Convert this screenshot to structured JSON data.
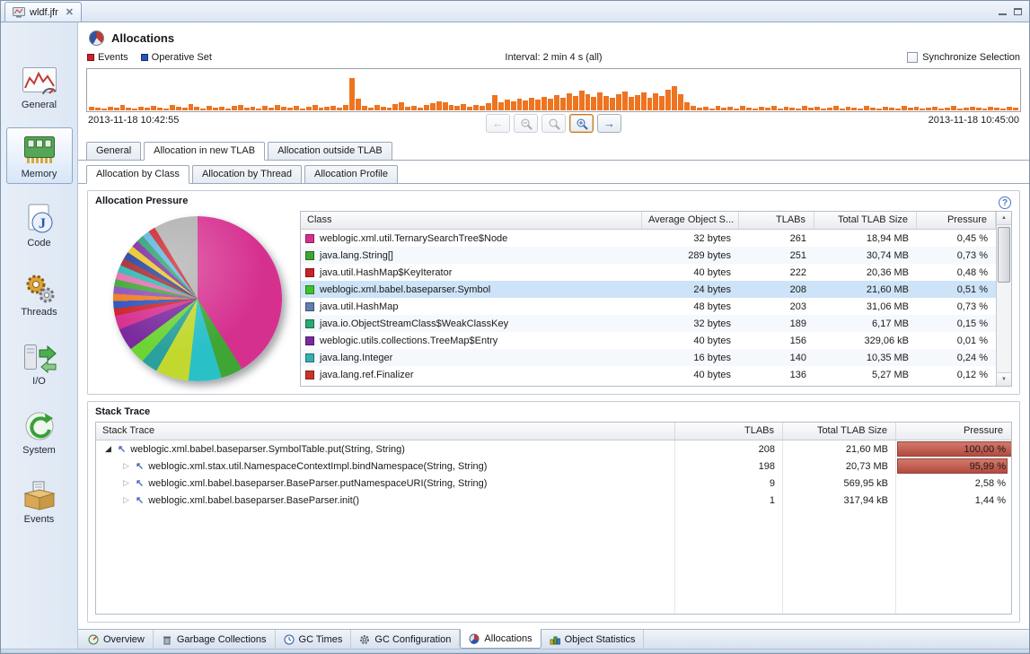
{
  "window": {
    "tab_title": "wldf.jfr"
  },
  "sidebar": {
    "items": [
      {
        "label": "General",
        "selected": false
      },
      {
        "label": "Memory",
        "selected": true
      },
      {
        "label": "Code",
        "selected": false
      },
      {
        "label": "Threads",
        "selected": false
      },
      {
        "label": "I/O",
        "selected": false
      },
      {
        "label": "System",
        "selected": false
      },
      {
        "label": "Events",
        "selected": false
      }
    ]
  },
  "header": {
    "title": "Allocations"
  },
  "timeline": {
    "legend": [
      {
        "label": "Events",
        "color": "#cc2229"
      },
      {
        "label": "Operative Set",
        "color": "#2a52be"
      }
    ],
    "interval_label": "Interval: 2 min 4 s (all)",
    "sync_label": "Synchronize Selection",
    "start_time": "2013-11-18 10:42:55",
    "end_time": "2013-11-18 10:45:00",
    "bar_color": "#ee7420",
    "bars": [
      4,
      3,
      2,
      4,
      3,
      6,
      3,
      2,
      4,
      3,
      5,
      3,
      2,
      6,
      4,
      3,
      7,
      4,
      2,
      5,
      3,
      4,
      2,
      5,
      6,
      3,
      4,
      2,
      5,
      3,
      6,
      4,
      3,
      5,
      2,
      4,
      6,
      3,
      4,
      5,
      3,
      6,
      36,
      13,
      5,
      3,
      6,
      4,
      3,
      7,
      9,
      4,
      5,
      3,
      6,
      8,
      10,
      9,
      6,
      5,
      7,
      4,
      6,
      5,
      8,
      17,
      9,
      12,
      10,
      13,
      11,
      14,
      12,
      15,
      13,
      17,
      14,
      19,
      16,
      22,
      18,
      15,
      20,
      16,
      14,
      18,
      21,
      15,
      17,
      20,
      14,
      19,
      16,
      23,
      27,
      18,
      9,
      5,
      3,
      4,
      2,
      5,
      3,
      4,
      2,
      5,
      3,
      2,
      4,
      3,
      5,
      2,
      4,
      3,
      2,
      5,
      3,
      4,
      2,
      3,
      5,
      2,
      4,
      3,
      2,
      5,
      3,
      2,
      4,
      3,
      2,
      5,
      3,
      4,
      2,
      3,
      4,
      2,
      3,
      5,
      2,
      3,
      4,
      3,
      2,
      4,
      3,
      2,
      4,
      3
    ]
  },
  "tabs": {
    "main": [
      {
        "label": "General",
        "selected": false
      },
      {
        "label": "Allocation in new TLAB",
        "selected": true
      },
      {
        "label": "Allocation outside TLAB",
        "selected": false
      }
    ],
    "sub": [
      {
        "label": "Allocation by Class",
        "selected": true
      },
      {
        "label": "Allocation by Thread",
        "selected": false
      },
      {
        "label": "Allocation Profile",
        "selected": false
      }
    ]
  },
  "allocation_pressure": {
    "title": "Allocation Pressure",
    "table": {
      "columns": [
        "Class",
        "Average Object S...",
        "TLABs",
        "Total TLAB Size",
        "Pressure"
      ],
      "rows": [
        {
          "class": "weblogic.xml.util.TernarySearchTree$Node",
          "color": "#d6308f",
          "avg_object_size": "32 bytes",
          "tlabs": "261",
          "total_tlab_size": "18,94 MB",
          "pressure": "0,45 %",
          "selected": false
        },
        {
          "class": "java.lang.String[]",
          "color": "#3fa535",
          "avg_object_size": "289 bytes",
          "tlabs": "251",
          "total_tlab_size": "30,74 MB",
          "pressure": "0,73 %",
          "selected": false
        },
        {
          "class": "java.util.HashMap$KeyIterator",
          "color": "#cc2229",
          "avg_object_size": "40 bytes",
          "tlabs": "222",
          "total_tlab_size": "20,36 MB",
          "pressure": "0,48 %",
          "selected": false
        },
        {
          "class": "weblogic.xml.babel.baseparser.Symbol",
          "color": "#3fc32a",
          "avg_object_size": "24 bytes",
          "tlabs": "208",
          "total_tlab_size": "21,60 MB",
          "pressure": "0,51 %",
          "selected": true
        },
        {
          "class": "java.util.HashMap",
          "color": "#5f7fae",
          "avg_object_size": "48 bytes",
          "tlabs": "203",
          "total_tlab_size": "31,06 MB",
          "pressure": "0,73 %",
          "selected": false
        },
        {
          "class": "java.io.ObjectStreamClass$WeakClassKey",
          "color": "#2aa875",
          "avg_object_size": "32 bytes",
          "tlabs": "189",
          "total_tlab_size": "6,17 MB",
          "pressure": "0,15 %",
          "selected": false
        },
        {
          "class": "weblogic.utils.collections.TreeMap$Entry",
          "color": "#7a2a9e",
          "avg_object_size": "40 bytes",
          "tlabs": "156",
          "total_tlab_size": "329,06 kB",
          "pressure": "0,01 %",
          "selected": false
        },
        {
          "class": "java.lang.Integer",
          "color": "#35b0b0",
          "avg_object_size": "16 bytes",
          "tlabs": "140",
          "total_tlab_size": "10,35 MB",
          "pressure": "0,24 %",
          "selected": false
        },
        {
          "class": "java.lang.ref.Finalizer",
          "color": "#c8342a",
          "avg_object_size": "40 bytes",
          "tlabs": "136",
          "total_tlab_size": "5,27 MB",
          "pressure": "0,12 %",
          "selected": false
        }
      ]
    }
  },
  "pie": {
    "slices": [
      {
        "color": "#d6308f",
        "value": 38
      },
      {
        "color": "#3fa535",
        "value": 4
      },
      {
        "color": "#2ac0c8",
        "value": 6
      },
      {
        "color": "#c2d82e",
        "value": 6
      },
      {
        "color": "#2aa19e",
        "value": 3
      },
      {
        "color": "#6dd435",
        "value": 3
      },
      {
        "color": "#7a2a9e",
        "value": 4
      },
      {
        "color": "#d6308f",
        "value": 2.5
      },
      {
        "color": "#cc2229",
        "value": 1.3
      },
      {
        "color": "#2a52be",
        "value": 1.3
      },
      {
        "color": "#ef7a21",
        "value": 1.3
      },
      {
        "color": "#8a4fb8",
        "value": 1.3
      },
      {
        "color": "#3fa535",
        "value": 1.3
      },
      {
        "color": "#e06fae",
        "value": 1.3
      },
      {
        "color": "#29b6b0",
        "value": 1.3
      },
      {
        "color": "#a5262c",
        "value": 1.3
      },
      {
        "color": "#1f3f9e",
        "value": 1.3
      },
      {
        "color": "#e8c520",
        "value": 1.3
      },
      {
        "color": "#7a2a9e",
        "value": 1.3
      },
      {
        "color": "#2a9e6e",
        "value": 1.3
      },
      {
        "color": "#5ab4e0",
        "value": 1.3
      },
      {
        "color": "#cc2229",
        "value": 1.3
      },
      {
        "color": "#b0b0b0",
        "value": 8
      }
    ]
  },
  "stack_trace": {
    "title": "Stack Trace",
    "columns": [
      "Stack Trace",
      "TLABs",
      "Total TLAB Size",
      "Pressure"
    ],
    "rows": [
      {
        "frame": "weblogic.xml.babel.baseparser.SymbolTable.put(String, String)",
        "tlabs": "208",
        "total_tlab_size": "21,60 MB",
        "pressure": "100,00 %",
        "level": 0,
        "state": "expanded",
        "bar_pct": 100
      },
      {
        "frame": "weblogic.xml.stax.util.NamespaceContextImpl.bindNamespace(String, String)",
        "tlabs": "198",
        "total_tlab_size": "20,73 MB",
        "pressure": "95,99 %",
        "level": 1,
        "state": "collapsed",
        "bar_pct": 96
      },
      {
        "frame": "weblogic.xml.babel.baseparser.BaseParser.putNamespaceURI(String, String)",
        "tlabs": "9",
        "total_tlab_size": "569,95 kB",
        "pressure": "2,58 %",
        "level": 1,
        "state": "collapsed",
        "bar_pct": 0
      },
      {
        "frame": "weblogic.xml.babel.baseparser.BaseParser.init()",
        "tlabs": "1",
        "total_tlab_size": "317,94 kB",
        "pressure": "1,44 %",
        "level": 1,
        "state": "collapsed",
        "bar_pct": 0
      }
    ]
  },
  "bottom_tabs": [
    {
      "label": "Overview",
      "selected": false
    },
    {
      "label": "Garbage Collections",
      "selected": false
    },
    {
      "label": "GC Times",
      "selected": false
    },
    {
      "label": "GC Configuration",
      "selected": false
    },
    {
      "label": "Allocations",
      "selected": true
    },
    {
      "label": "Object Statistics",
      "selected": false
    }
  ]
}
